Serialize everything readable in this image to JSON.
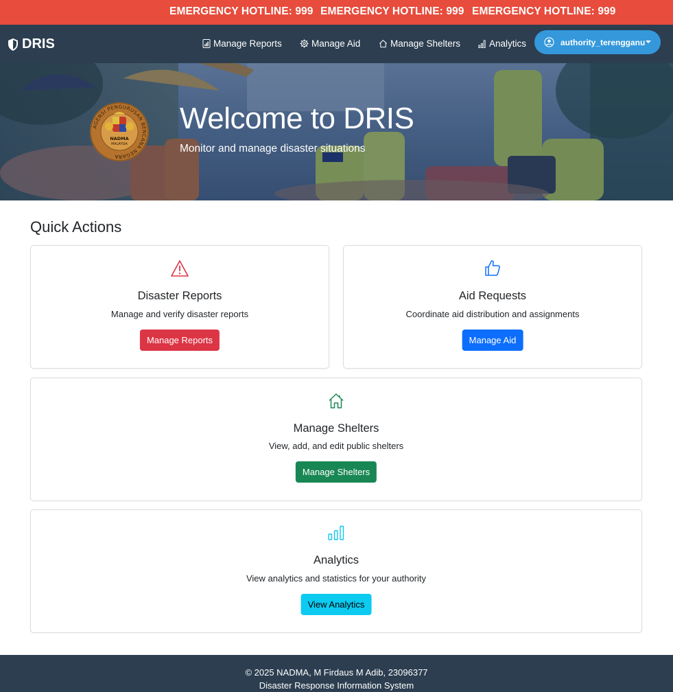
{
  "ticker": {
    "items": [
      "EMERGENCY HOTLINE: 999",
      "EMERGENCY HOTLINE: 999",
      "EMERGENCY HOTLINE: 999"
    ]
  },
  "navbar": {
    "brand": "DRIS",
    "links": [
      "Manage Reports",
      "Manage Aid",
      "Manage Shelters",
      "Analytics"
    ],
    "user": "authority_terengganu"
  },
  "hero": {
    "title": "Welcome to DRIS",
    "subtitle": "Monitor and manage disaster situations",
    "logo_text": "AGENSI PENGURUSAN BENCANA NEGARA",
    "logo_inner": [
      "NADMA",
      "MALAYSIA"
    ]
  },
  "quick_actions": {
    "heading": "Quick Actions",
    "cards": [
      {
        "title": "Disaster Reports",
        "description": "Manage and verify disaster reports",
        "button": "Manage Reports",
        "color": "#dc3545",
        "icon": "warning-triangle-icon"
      },
      {
        "title": "Aid Requests",
        "description": "Coordinate aid distribution and assignments",
        "button": "Manage Aid",
        "color": "#0d6efd",
        "icon": "thumbs-up-icon"
      },
      {
        "title": "Manage Shelters",
        "description": "View, add, and edit public shelters",
        "button": "Manage Shelters",
        "color": "#198754",
        "icon": "house-icon"
      },
      {
        "title": "Analytics",
        "description": "View analytics and statistics for your authority",
        "button": "View Analytics",
        "color": "#0dcaf0",
        "icon": "bar-chart-icon"
      }
    ]
  },
  "footer": {
    "line1": "© 2025 NADMA, M Firdaus M Adib, 23096377",
    "line2": "Disaster Response Information System"
  },
  "colors": {
    "ticker_bg": "#e74c3c",
    "navbar_bg": "#2c3e50",
    "user_button_bg": "#3498db"
  }
}
